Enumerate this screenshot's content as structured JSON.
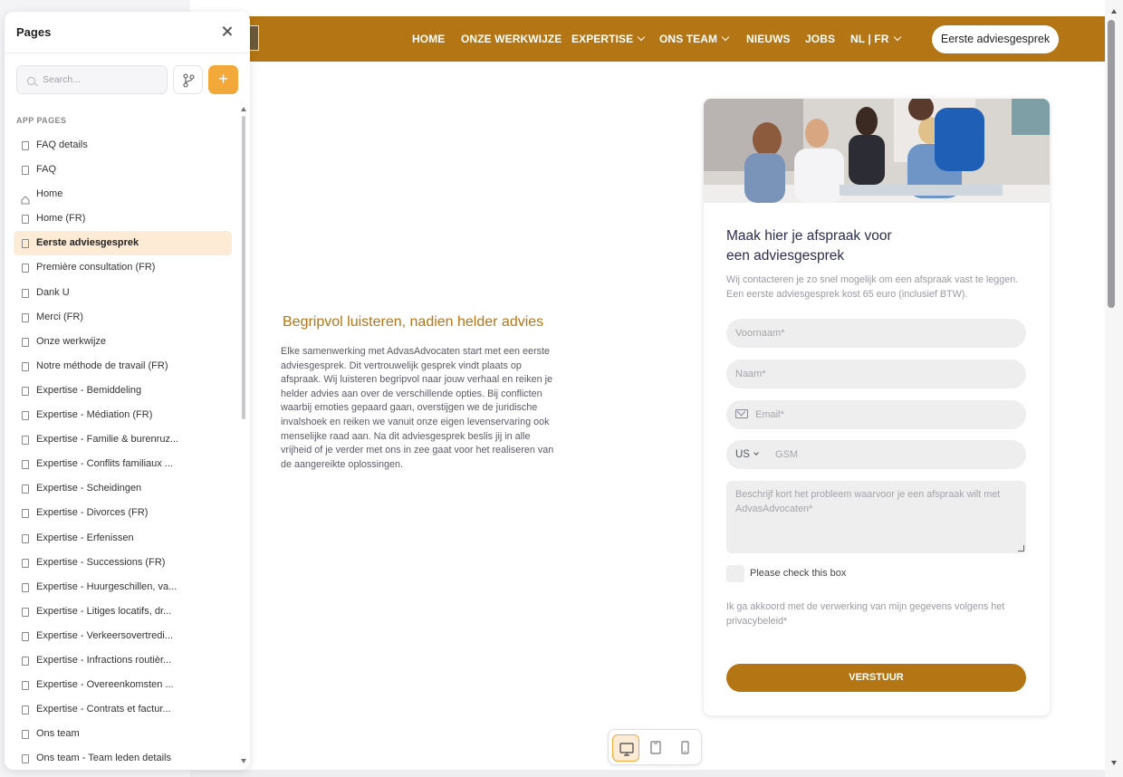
{
  "navbar": {
    "items": [
      {
        "label": "HOME"
      },
      {
        "label": "ONZE WERKWIJZE"
      },
      {
        "label": "EXPERTISE"
      },
      {
        "label": "ONS TEAM"
      },
      {
        "label": "NIEUWS"
      },
      {
        "label": "JOBS"
      },
      {
        "label": "NL | FR"
      }
    ],
    "cta_label": "Eerste adviesgesprek",
    "color": "#b47614"
  },
  "intro": {
    "headline": "Begripvol luisteren, nadien helder advies",
    "body": "Elke samenwerking met AdvasAdvocaten start met een eerste adviesgesprek. Dit vertrouwelijk gesprek vindt plaats op afspraak. Wij luisteren begripvol naar jouw verhaal en reiken je helder advies aan over de verschillende opties. Bij conflicten waarbij emoties gepaard gaan, overstijgen we de juridische invalshoek en reiken we vanuit onze eigen levenservaring ook menselijke raad aan. Na dit adviesgesprek beslis jij in alle vrijheid of je verder met ons in zee gaat voor het realiseren van de aangereikte oplossingen."
  },
  "form": {
    "title_line1": "Maak hier je afspraak voor",
    "title_line2": "een adviesgesprek",
    "subtitle": "Wij contacteren je zo snel mogelijk om een afspraak vast te leggen. Een eerste adviesgesprek kost 65 euro (inclusief BTW).",
    "firstname_placeholder": "Voornaam*",
    "lastname_placeholder": "Naam*",
    "email_placeholder": "Email*",
    "country_code": "US",
    "phone_placeholder": "GSM",
    "message_placeholder": "Beschrijf kort het probleem waarvoor je een afspraak wilt met AdvasAdvocaten*",
    "checkbox_label": "Please check this box",
    "privacy_text": "Ik ga akkoord met de verwerking van mijn gegevens volgens het privacybeleid*",
    "submit_label": "VERSTUUR"
  },
  "sidebar": {
    "title": "Pages",
    "search_placeholder": "Search...",
    "add_label": "+",
    "section_label": "APP PAGES",
    "active_index": 4,
    "accent": "#f3a93a",
    "pages": [
      {
        "label": "FAQ details",
        "icon": "document-icon"
      },
      {
        "label": "FAQ",
        "icon": "document-icon"
      },
      {
        "label": "Home",
        "icon": "home-icon"
      },
      {
        "label": "Home (FR)",
        "icon": "document-icon"
      },
      {
        "label": "Eerste adviesgesprek",
        "icon": "document-icon"
      },
      {
        "label": "Première consultation (FR)",
        "icon": "document-icon"
      },
      {
        "label": "Dank U",
        "icon": "document-icon"
      },
      {
        "label": "Merci (FR)",
        "icon": "document-icon"
      },
      {
        "label": "Onze werkwijze",
        "icon": "document-icon"
      },
      {
        "label": "Notre méthode de travail (FR)",
        "icon": "document-icon"
      },
      {
        "label": "Expertise - Bemiddeling",
        "icon": "document-icon"
      },
      {
        "label": "Expertise - Médiation (FR)",
        "icon": "document-icon"
      },
      {
        "label": "Expertise - Familie & burenruz...",
        "icon": "document-icon"
      },
      {
        "label": "Expertise - Conflits familiaux ...",
        "icon": "document-icon"
      },
      {
        "label": "Expertise - Scheidingen",
        "icon": "document-icon"
      },
      {
        "label": "Expertise - Divorces (FR)",
        "icon": "document-icon"
      },
      {
        "label": "Expertise - Erfenissen",
        "icon": "document-icon"
      },
      {
        "label": "Expertise - Successions (FR)",
        "icon": "document-icon"
      },
      {
        "label": "Expertise - Huurgeschillen, va...",
        "icon": "document-icon"
      },
      {
        "label": "Expertise - Litiges locatifs, dr...",
        "icon": "document-icon"
      },
      {
        "label": "Expertise - Verkeersovertredi...",
        "icon": "document-icon"
      },
      {
        "label": "Expertise - Infractions routièr...",
        "icon": "document-icon"
      },
      {
        "label": "Expertise - Overeenkomsten ...",
        "icon": "document-icon"
      },
      {
        "label": "Expertise - Contrats et factur...",
        "icon": "document-icon"
      },
      {
        "label": "Ons team",
        "icon": "document-icon"
      },
      {
        "label": "Ons team - Team leden details",
        "icon": "document-icon"
      }
    ]
  },
  "device_switcher": {
    "options": [
      "desktop",
      "tablet",
      "mobile"
    ],
    "selected": "desktop"
  }
}
